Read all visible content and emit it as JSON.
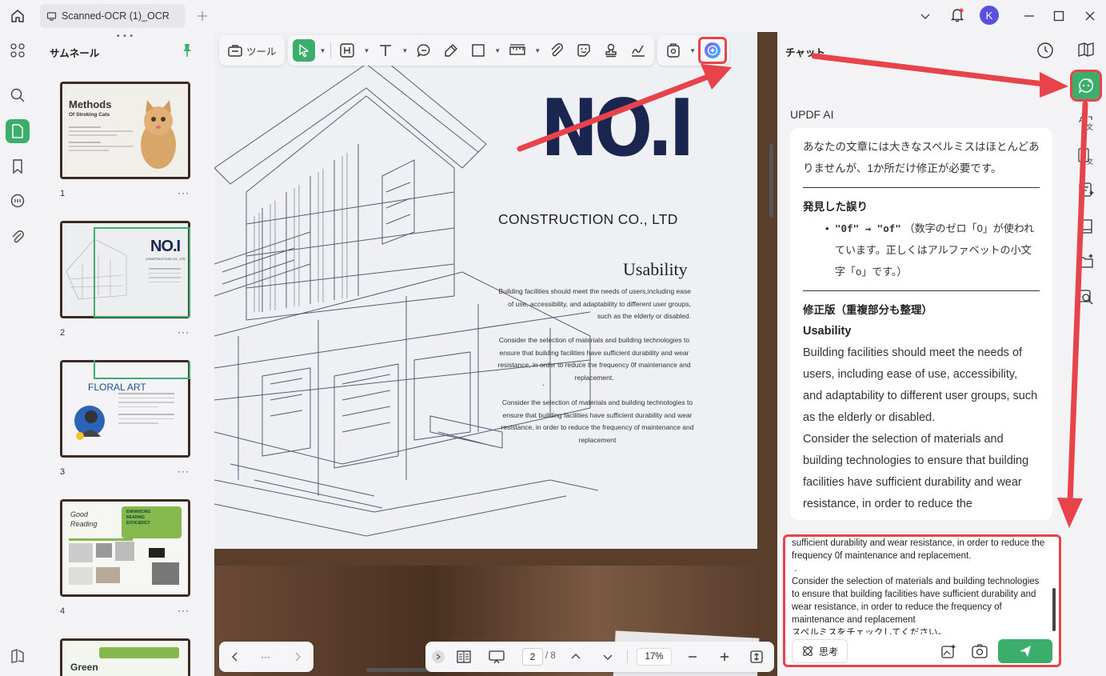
{
  "tab": {
    "title": "Scanned-OCR (1)_OCR"
  },
  "user": {
    "initial": "K"
  },
  "thumbnails": {
    "title": "サムネール",
    "pages": [
      {
        "num": "1",
        "heading": "Methods",
        "sub": "Of Stroking Cats"
      },
      {
        "num": "2",
        "heading": "NO.I",
        "sub": "CONSTRUCTION CO., LTD"
      },
      {
        "num": "3",
        "heading": "FLORAL ART"
      },
      {
        "num": "4",
        "heading": "Good Reading",
        "sub": "ENHANCING READING EFFICIENCY"
      },
      {
        "num": "",
        "heading": "Green"
      }
    ],
    "more": "···"
  },
  "toolbar": {
    "tools_label": "ツール"
  },
  "document": {
    "logo": "NO.I",
    "company": "CONSTRUCTION CO., LTD",
    "heading": "Usability",
    "para1": "Building facilities should meet the needs of users,including ease of use, accessibility, and adaptability to different user groups, such as the elderly or disabled.",
    "para2": "Consider the selection of materials and building technologies to ensure that building facilities have sufficient durability and wear resistance, in order to reduce the frequency 0f maintenance and replacement.",
    "dot": ".",
    "para3": "Consider the selection of materials and building technologies to ensure that building facilities have sufficient durability and wear resistance, in order to reduce the frequency of maintenance and replacement"
  },
  "pager": {
    "current": "2",
    "total": "/ 8",
    "zoom": "17%",
    "ellipsis": "···"
  },
  "chat": {
    "title": "チャット",
    "ai_name": "UPDF AI",
    "intro": "あなたの文章には大きなスペルミスはほとんどありませんが、1か所だけ修正が必要です。",
    "found_heading": "発見した誤り",
    "bullet_code": "\"0f\" → \"of\"",
    "bullet_text": "（数字のゼロ「0」が使われています。正しくはアルファベットの小文字「o」です。）",
    "fixed_heading": "修正版（重複部分も整理）",
    "fixed_title": "Usability",
    "fixed_body1": "Building facilities should meet the needs of users, including ease of use, accessibility, and adaptability to different user groups, such as the elderly or disabled.",
    "fixed_body2": "Consider the selection of materials and building technologies to ensure that building facilities have sufficient durability and wear resistance, in order to reduce the",
    "input_text": "sufficient durability and wear resistance, in order to reduce the frequency 0f maintenance and replacement.\n .\nConsider the selection of materials and building technologies to ensure that building facilities have sufficient durability and wear resistance, in order to reduce the frequency of maintenance and replacement\nスペルミスをチェックしてください。",
    "think_label": "思考"
  },
  "colors": {
    "accent": "#3cae6c",
    "highlight": "#e8424a",
    "logo": "#1a2550"
  }
}
